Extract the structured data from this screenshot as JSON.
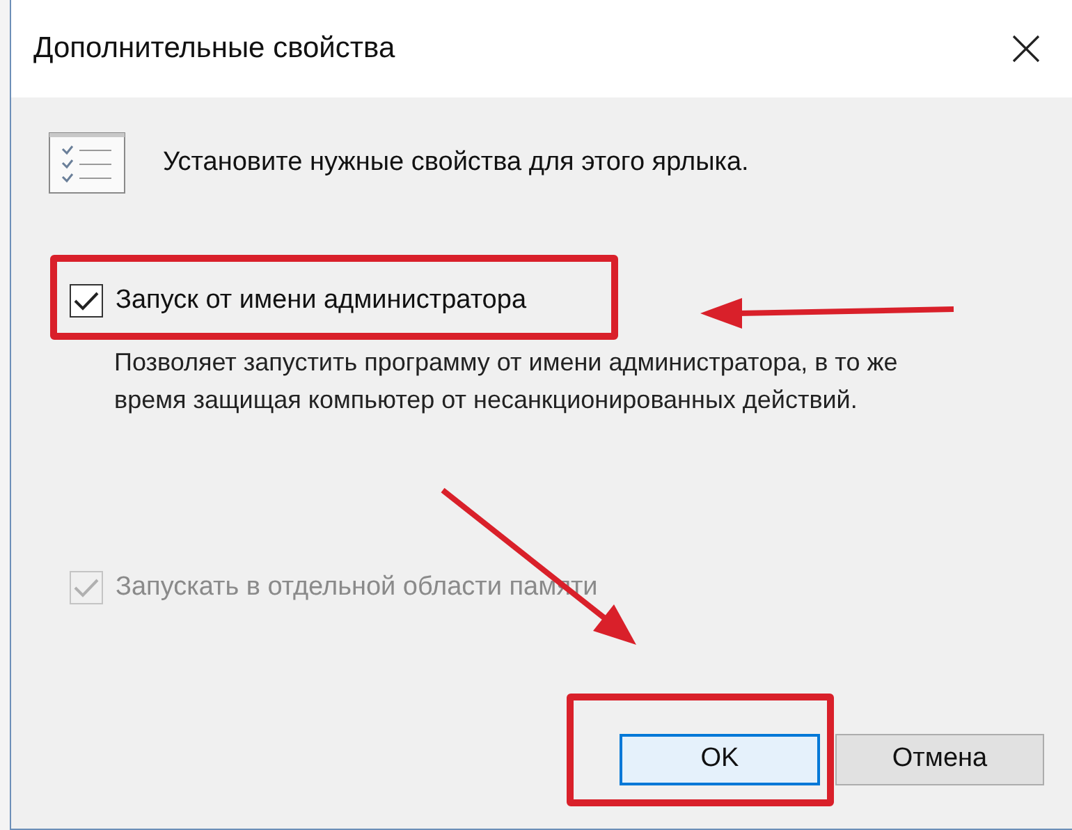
{
  "window": {
    "title": "Дополнительные свойства"
  },
  "header": {
    "text": "Установите нужные свойства для этого ярлыка."
  },
  "options": [
    {
      "label": "Запуск от имени администратора",
      "checked": true,
      "disabled": false,
      "description": "Позволяет запустить программу от имени администратора, в то же время защищая компьютер от несанкционированных действий."
    },
    {
      "label": "Запускать в отдельной области памяти",
      "checked": true,
      "disabled": true
    }
  ],
  "buttons": [
    {
      "label": "OK",
      "selected": true
    },
    {
      "label": "Отмена",
      "selected": false
    }
  ]
}
